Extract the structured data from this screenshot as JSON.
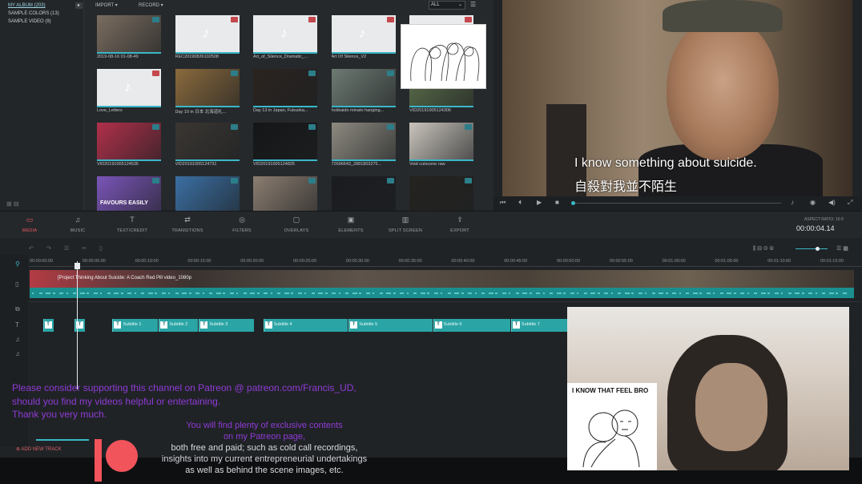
{
  "library": {
    "albums": [
      {
        "label": "MY ALBUM (203)",
        "active": true
      },
      {
        "label": "SAMPLE COLORS (13)",
        "active": false
      },
      {
        "label": "SAMPLE VIDEO (9)",
        "active": false
      }
    ],
    "menu_import": "IMPORT ▾",
    "menu_record": "RECORD ▾",
    "filter_value": "ALL",
    "tiles": [
      {
        "name": "2019-08-16 01-08-49",
        "kind": "video",
        "thumb": "#7a6d60"
      },
      {
        "name": "REC20190826102508",
        "kind": "audio",
        "thumb": ""
      },
      {
        "name": "Art_of_Silence_Dramatic_...",
        "kind": "audio",
        "thumb": ""
      },
      {
        "name": "Art Of Silence_V2",
        "kind": "audio",
        "thumb": ""
      },
      {
        "name": "",
        "kind": "audio",
        "thumb": ""
      },
      {
        "name": "Love_Letters",
        "kind": "audio",
        "thumb": ""
      },
      {
        "name": "Day 10 in 日本 北海道札...",
        "kind": "video",
        "thumb": "#8a6a3d"
      },
      {
        "name": "Day 13 in Japan, Fukuoka...",
        "kind": "video",
        "thumb": "#2a2420"
      },
      {
        "name": "hokkaido minato hanging...",
        "kind": "video",
        "thumb": "#6d7a72"
      },
      {
        "name": "VID20191005124306",
        "kind": "video",
        "thumb": "#5b6e4a"
      },
      {
        "name": "VID20191005124535",
        "kind": "video",
        "thumb": "#b0304a"
      },
      {
        "name": "VID20191005124731",
        "kind": "video",
        "thumb": "#3a3632"
      },
      {
        "name": "VID20191005124825",
        "kind": "video",
        "thumb": "#141618"
      },
      {
        "name": "72696643_2881803275...",
        "kind": "video",
        "thumb": "#8d8a80"
      },
      {
        "name": "Void cutscene raw",
        "kind": "video",
        "thumb": "#c9c4bc"
      },
      {
        "name": "",
        "kind": "video",
        "thumb": "#7a55b8"
      },
      {
        "name": "",
        "kind": "video",
        "thumb": "#3b6fa3"
      },
      {
        "name": "",
        "kind": "video",
        "thumb": "#8b7d70"
      },
      {
        "name": "",
        "kind": "video",
        "thumb": "#1b1c20"
      },
      {
        "name": "",
        "kind": "video",
        "thumb": "#24231f"
      }
    ],
    "thumb_text_favours": "FAVOURS EASILY"
  },
  "preview": {
    "subtitle_en": "I know something about suicide.",
    "subtitle_zh": "自殺對我並不陌生"
  },
  "toolbar": {
    "items": [
      {
        "label": "MEDIA",
        "icon": "▭",
        "active": true
      },
      {
        "label": "MUSIC",
        "icon": "♫",
        "active": false
      },
      {
        "label": "TEXT/CREDIT",
        "icon": "T",
        "active": false
      },
      {
        "label": "TRANSITIONS",
        "icon": "⇄",
        "active": false
      },
      {
        "label": "FILTERS",
        "icon": "◎",
        "active": false
      },
      {
        "label": "OVERLAYS",
        "icon": "▢",
        "active": false
      },
      {
        "label": "ELEMENTS",
        "icon": "▣",
        "active": false
      },
      {
        "label": "SPLIT SCREEN",
        "icon": "▥",
        "active": false
      },
      {
        "label": "EXPORT",
        "icon": "⇪",
        "active": false
      }
    ],
    "aspect_ratio": "ASPECT RATIO: 16:9",
    "timecode": "00:00:04.14"
  },
  "timeline": {
    "ticks": [
      "00:00:00:00",
      "00:00:05:00",
      "00:00:10:00",
      "00:00:15:00",
      "00:00:20:00",
      "00:00:25:00",
      "00:00:30:00",
      "00:00:35:00",
      "00:00:40:00",
      "00:00:45:00",
      "00:00:50:00",
      "00:00:55:00",
      "00:01:00:00",
      "00:01:05:00",
      "00:01:10:00",
      "00:01:15:00"
    ],
    "clip_title": "[Project Thinking About Suicide: A Coach Red Pill video_1080p",
    "title_clips": [
      {
        "label": "",
        "start": 0.2
      },
      {
        "label": "",
        "start": 3.2
      },
      {
        "label": "Subtitle 1",
        "start": 6.8
      },
      {
        "label": "Subtitle 2",
        "start": 11.2
      },
      {
        "label": "Subtitle 3",
        "start": 15.0
      },
      {
        "label": "Subtitle 4",
        "start": 21.1
      },
      {
        "label": "Subtitle 5",
        "start": 29.2
      },
      {
        "label": "Subtitle 6",
        "start": 37.2
      },
      {
        "label": "Subtitle 7",
        "start": 44.6
      },
      {
        "label": "",
        "start": 50.4
      }
    ],
    "add_track": "ADD NEW TRACK"
  },
  "overlay": {
    "patreon_line1": "Please consider supporting this channel on Patreon @ patreon.com/Francis_UD,",
    "patreon_line2": "should you find my videos helpful or entertaining.",
    "patreon_line3": "Thank you very much.",
    "sub_line1": "You will find plenty of exclusive contents",
    "sub_line2": "on my Patreon page,",
    "sub_line3": "both free and paid; such as cold call recordings,",
    "sub_line4": "insights into my current entrepreneurial undertakings",
    "sub_line5": "as well as behind the scene images, etc.",
    "meme_text": "I KNOW THAT FEEL BRO",
    "patreon_color": "#f2545b",
    "purple": "#8f3bd6"
  }
}
